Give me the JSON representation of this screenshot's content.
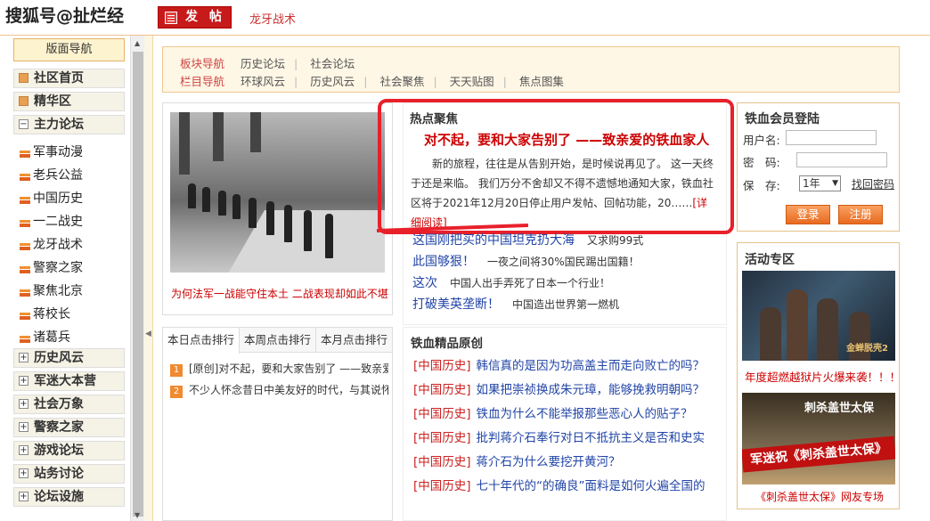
{
  "header": {
    "watermark": "搜狐号@扯烂经",
    "post_button": "发 帖",
    "board_link": "龙牙战术"
  },
  "sidebar": {
    "title": "版面导航",
    "items": [
      {
        "label": "社区首页",
        "kind": "main",
        "icon": "orange-square-icon"
      },
      {
        "label": "精华区",
        "kind": "main",
        "icon": "orange-square-icon"
      },
      {
        "label": "主力论坛",
        "kind": "main",
        "icon": "collapse-icon"
      },
      {
        "label": "军事动漫",
        "kind": "sub"
      },
      {
        "label": "老兵公益",
        "kind": "sub"
      },
      {
        "label": "中国历史",
        "kind": "sub"
      },
      {
        "label": "一二战史",
        "kind": "sub"
      },
      {
        "label": "龙牙战术",
        "kind": "sub"
      },
      {
        "label": "警察之家",
        "kind": "sub"
      },
      {
        "label": "聚焦北京",
        "kind": "sub"
      },
      {
        "label": "蒋校长",
        "kind": "sub"
      },
      {
        "label": "诸葛兵",
        "kind": "sub"
      },
      {
        "label": "历史风云",
        "kind": "main",
        "icon": "expand-icon"
      },
      {
        "label": "军迷大本营",
        "kind": "main",
        "icon": "expand-icon"
      },
      {
        "label": "社会万象",
        "kind": "main",
        "icon": "expand-icon"
      },
      {
        "label": "警察之家",
        "kind": "main",
        "icon": "expand-icon"
      },
      {
        "label": "游戏论坛",
        "kind": "main",
        "icon": "expand-icon"
      },
      {
        "label": "站务讨论",
        "kind": "main",
        "icon": "expand-icon"
      },
      {
        "label": "论坛设施",
        "kind": "main",
        "icon": "expand-icon"
      }
    ]
  },
  "subnav": {
    "row1": {
      "title": "板块导航",
      "items": [
        "历史论坛",
        "社会论坛"
      ]
    },
    "row2": {
      "title": "栏目导航",
      "items": [
        "环球风云",
        "历史风云",
        "社会聚焦",
        "天天贴图",
        "焦点图集"
      ]
    }
  },
  "photo": {
    "caption": "为何法军一战能守住本土 二战表现却如此不堪"
  },
  "hot": {
    "title": "热点聚焦",
    "headline": "对不起，要和大家告别了 ——致亲爱的铁血家人",
    "body": "新的旅程，往往是从告别开始，是时候说再见了。 这一天终于还是来临。 我们万分不舍却又不得不遗憾地通知大家，铁血社区将于2021年12月20日停止用户发帖、回帖功能，20……",
    "more": "[详细阅读]"
  },
  "news": [
    {
      "headline": "这国刚把买的中国坦克扔大海",
      "sub": "又求购99式"
    },
    {
      "headline": "此国够狠！",
      "sub": "一夜之间将30%国民踢出国籍！"
    },
    {
      "headline": "这次",
      "sub": "中国人出手弄死了日本一个行业！"
    },
    {
      "headline": "打破美英垄断！",
      "sub": "中国造出世界第一燃机"
    }
  ],
  "rank": {
    "tabs": [
      "本日点击排行",
      "本周点击排行",
      "本月点击排行"
    ],
    "items": [
      {
        "n": "1",
        "text": "[原创]对不起，要和大家告别了 ——致亲爱的铁血家人"
      },
      {
        "n": "2",
        "text": "不少人怀念昔日中美友好的时代，与其说怀念不如说"
      }
    ]
  },
  "best": {
    "title": "铁血精品原创",
    "items": [
      {
        "cat": "[中国历史]",
        "text": "韩信真的是因为功高盖主而走向败亡的吗？"
      },
      {
        "cat": "[中国历史]",
        "text": "如果把崇祯换成朱元璋，能够挽救明朝吗？"
      },
      {
        "cat": "[中国历史]",
        "text": "铁血为什么不能举报那些恶心人的贴子？"
      },
      {
        "cat": "[中国历史]",
        "text": "批判蒋介石奉行对日不抵抗主义是否和史实"
      },
      {
        "cat": "[中国历史]",
        "text": "蒋介石为什么要挖开黄河？"
      },
      {
        "cat": "[中国历史]",
        "text": "七十年代的“的确良”面料是如何火遍全国的"
      }
    ]
  },
  "login": {
    "title": "铁血会员登陆",
    "username_label": "用户名:",
    "password_label": "密　码:",
    "keep_label": "保　存:",
    "keep_value": "1年",
    "find_password": "找回密码",
    "login_button": "登录",
    "register_button": "注册"
  },
  "activity": {
    "title": "活动专区",
    "caption1": "年度超燃越狱片火爆来袭！！！",
    "img1_text": "金蝉脱壳2",
    "img2_top": "刺杀盖世太保",
    "img2_banner": "军迷祝《刺杀盖世太保》",
    "caption2": "《刺杀盖世太保》网友专场"
  },
  "colors": {
    "accent": "#c71a1a",
    "link": "#2144a6",
    "highlight_box": "#e8202a"
  }
}
